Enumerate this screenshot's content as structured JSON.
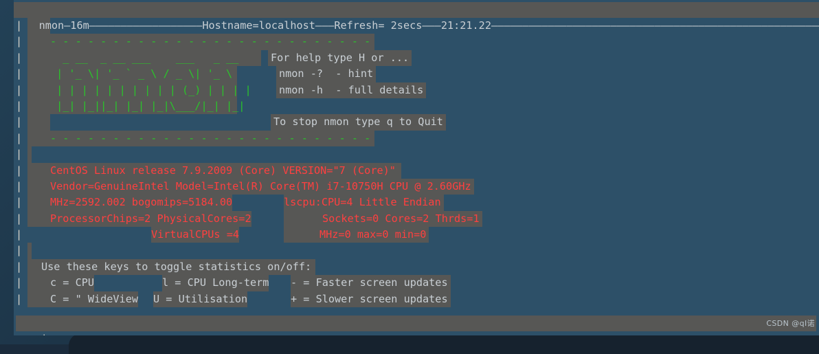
{
  "window": {
    "title": "nmon",
    "header": {
      "app": "nmon—16m",
      "hostname": "Hostname=localhost",
      "refresh": "Refresh= 2secs",
      "time": "21:21.22",
      "dash": "—",
      "cursor_color": "#2ad04a"
    },
    "colors": {
      "background": "#2d5068",
      "highlight": "#575755",
      "green": "#2ac52a",
      "red": "#ff4040",
      "text": "#c9cfd4",
      "border": "#d8d4c8",
      "desktop": "#1c3346"
    }
  },
  "logo": {
    "divider_top": "- - - - - - - - - - - - - - - - - - - - - - - - - -",
    "divider_bottom": "- - - - - - - - - - - - - - - - - - - - - - - - - -",
    "art": [
      "  _ __  _ __ ___    ___   _ __",
      " | '_ \\| '_ ` _ \\ / _ \\| '_ \\",
      " | | | | | | | | | | (_) | | | |",
      " |_| |_||_| |_| |_|\\___/|_| |_|"
    ]
  },
  "help": {
    "line1": "For help type H or ...",
    "line2": "nmon -?  - hint",
    "line3": "nmon -h  - full details",
    "line4": "To stop nmon type q to Quit"
  },
  "sysinfo": {
    "os": "CentOS Linux release 7.9.2009 (Core) VERSION=\"7 (Core)\"",
    "cpu": "Vendor=GenuineIntel Model=Intel(R) Core(TM) i7-10750H CPU @ 2.60GHz",
    "mhz_left": "MHz=2592.002 bogomips=5184.00",
    "lscpu": "lscpu:CPU=4 Little Endian",
    "chips_left": "ProcessorChips=2 PhysicalCores=2",
    "sockets": "Sockets=0 Cores=2 Thrds=1",
    "vcpus": "VirtualCPUs =4",
    "mhz_right": "MHz=0 max=0 min=0"
  },
  "keys": {
    "title": "Use these keys to toggle statistics on/off:",
    "row1": {
      "col1": "c = CPU",
      "col2": "l = CPU Long-term",
      "col3": "- = Faster screen updates"
    },
    "row2": {
      "col1": "C = \" WideView",
      "col2": "U = Utilisation",
      "col3": "+ = Slower screen updates"
    }
  },
  "footer": {
    "border_char": "—",
    "watermark": "CSDN @qI诺"
  }
}
